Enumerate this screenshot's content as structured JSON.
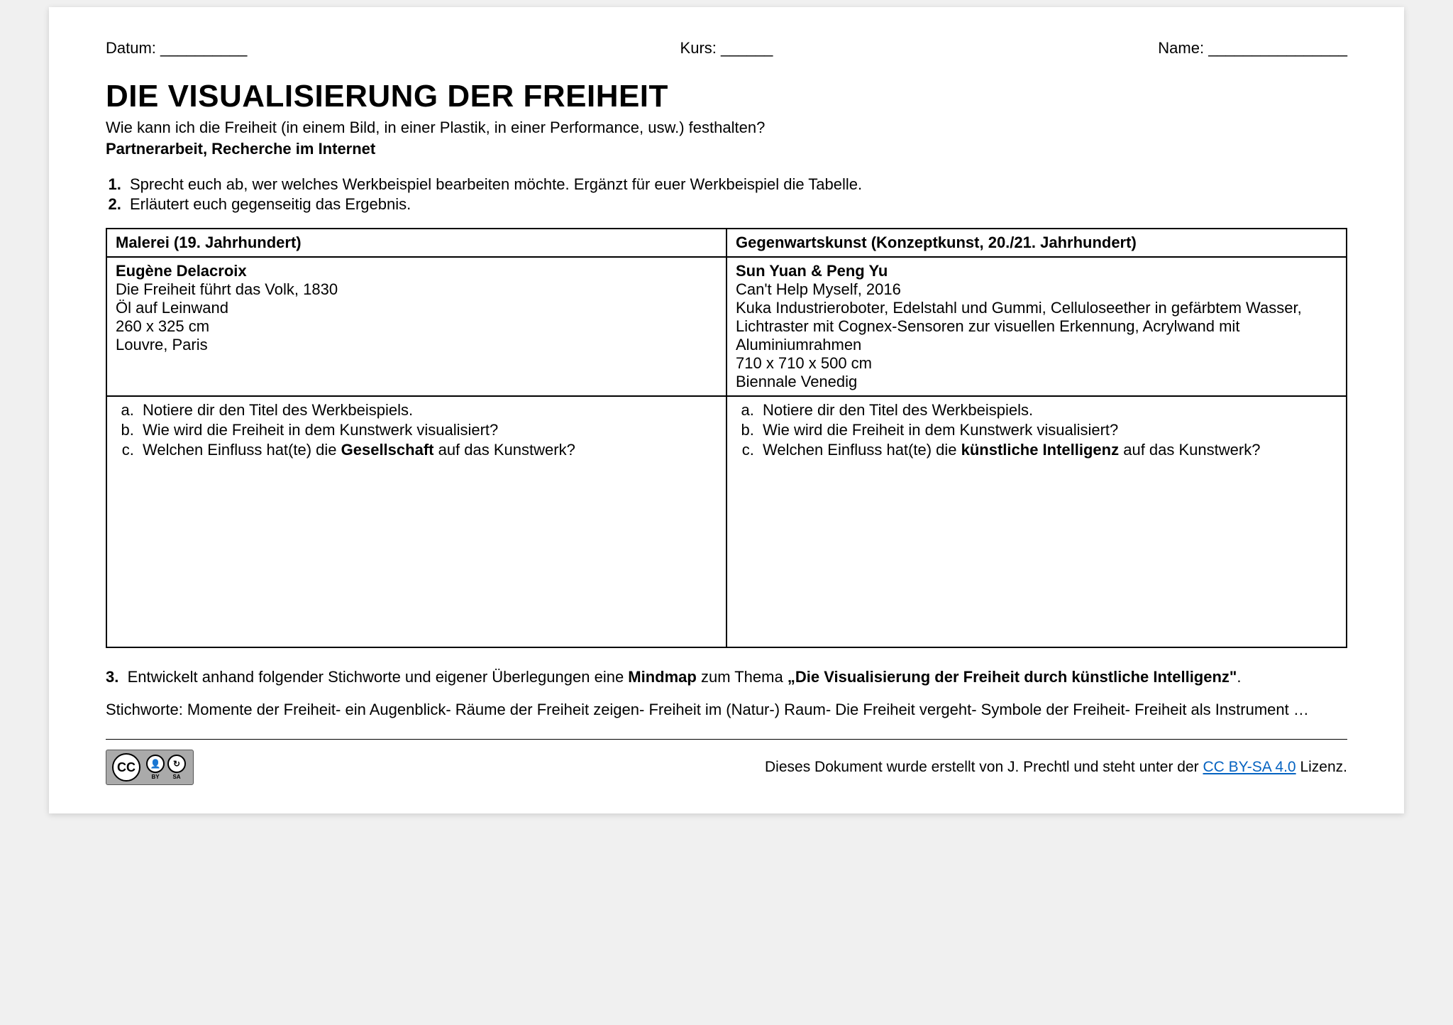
{
  "header": {
    "datum": "Datum: __________",
    "kurs": "Kurs: ______",
    "name": "Name: ________________"
  },
  "title": "DIE VISUALISIERUNG DER FREIHEIT",
  "subtitle": "Wie kann ich die Freiheit (in einem Bild, in einer Plastik, in einer Performance, usw.) festhalten?",
  "instruction_bold": "Partnerarbeit, Recherche im Internet",
  "tasks": {
    "t1": "Sprecht euch ab, wer welches Werkbeispiel bearbeiten möchte. Ergänzt für euer Werkbeispiel die Tabelle.",
    "t2": "Erläutert euch gegenseitig das Ergebnis."
  },
  "table": {
    "col1_header": "Malerei (19. Jahrhundert)",
    "col2_header": "Gegenwartskunst (Konzeptkunst, 20./21. Jahrhundert)",
    "col1_artist": "Eugène Delacroix",
    "col1_work": "Die Freiheit führt das Volk, 1830",
    "col1_medium": "Öl auf Leinwand",
    "col1_dims": "260 x 325 cm",
    "col1_location": "Louvre, Paris",
    "col2_artist": "Sun Yuan & Peng Yu",
    "col2_work": "Can't Help Myself, 2016",
    "col2_medium": "Kuka Industrieroboter, Edelstahl und Gummi, Celluloseether in gefärbtem Wasser, Lichtraster mit Cognex-Sensoren zur visuellen Erkennung, Acrylwand mit Aluminiumrahmen",
    "col2_dims": "710 x 710 x 500 cm",
    "col2_location": "Biennale Venedig",
    "col1_q_a": "Notiere dir den Titel des Werkbeispiels.",
    "col1_q_b": "Wie wird die Freiheit in dem Kunstwerk visualisiert?",
    "col1_q_c_pre": "Welchen Einfluss hat(te) die ",
    "col1_q_c_bold": "Gesellschaft",
    "col1_q_c_post": " auf das Kunstwerk?",
    "col2_q_a": "Notiere dir den Titel des Werkbeispiels.",
    "col2_q_b": "Wie wird die Freiheit in dem Kunstwerk visualisiert?",
    "col2_q_c_pre": "Welchen Einfluss hat(te) die ",
    "col2_q_c_bold": "künstliche Intelligenz",
    "col2_q_c_post": " auf das Kunstwerk?"
  },
  "task3": {
    "num": "3.",
    "pre": "Entwickelt anhand folgender Stichworte und eigener Überlegungen eine ",
    "bold1": "Mindmap",
    "mid": " zum Thema ",
    "bold2": "„Die Visualisierung der Freiheit durch künstliche Intelligenz\"",
    "post": "."
  },
  "stichworte": "Stichworte: Momente der Freiheit- ein Augenblick- Räume der Freiheit zeigen- Freiheit im (Natur-) Raum- Die Freiheit vergeht- Symbole der Freiheit- Freiheit als Instrument …",
  "footer": {
    "text_pre": "Dieses Dokument wurde erstellt von J. Prechtl und steht unter der ",
    "link_label": "CC BY-SA 4.0",
    "text_post": " Lizenz.",
    "cc": "CC",
    "by": "BY",
    "sa": "SA"
  }
}
